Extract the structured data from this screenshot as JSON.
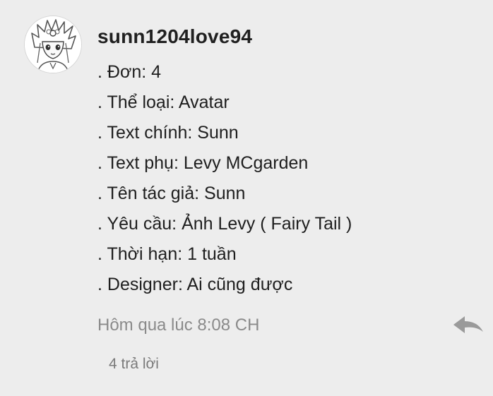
{
  "comment": {
    "username": "sunn1204love94",
    "lines": [
      ". Đơn: 4",
      ". Thể loại: Avatar",
      ". Text chính: Sunn",
      ". Text phụ: Levy MCgarden",
      ". Tên tác giả: Sunn",
      ". Yêu cầu: Ảnh Levy ( Fairy Tail )",
      ". Thời hạn: 1 tuần",
      ". Designer: Ai cũng được"
    ],
    "timestamp": "Hôm qua lúc 8:08 CH",
    "replies_label": "4 trả lời",
    "avatar_icon": "user-avatar-icon",
    "reply_icon": "reply-arrow-icon"
  },
  "colors": {
    "background": "#ededed",
    "text": "#1e1e1e",
    "muted": "#8a8a8a",
    "icon": "#9a9a9a"
  }
}
